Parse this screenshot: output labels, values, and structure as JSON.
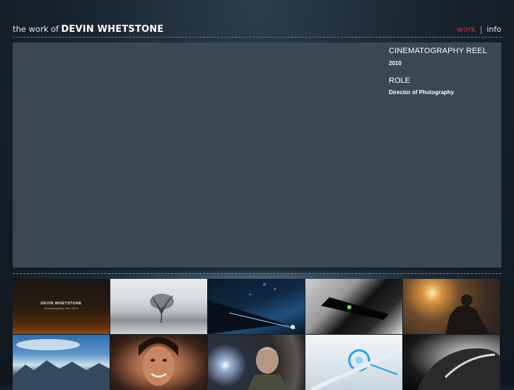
{
  "header": {
    "prefix": "the work of",
    "name": "DEVIN WHETSTONE",
    "nav": {
      "work": "work",
      "separator": "|",
      "info": "info"
    }
  },
  "project": {
    "title": "CINEMATOGRAPHY REEL",
    "year": "2010",
    "role_heading": "ROLE",
    "role": "Director of Photography"
  },
  "thumbnails": [
    {
      "caption_title": "DEVIN WHETSTONE",
      "caption_sub": "cinematography reel  |  2010"
    }
  ],
  "colors": {
    "accent": "#d0253f",
    "player_bg": "#3a4854",
    "page_bg": "#17222c"
  }
}
